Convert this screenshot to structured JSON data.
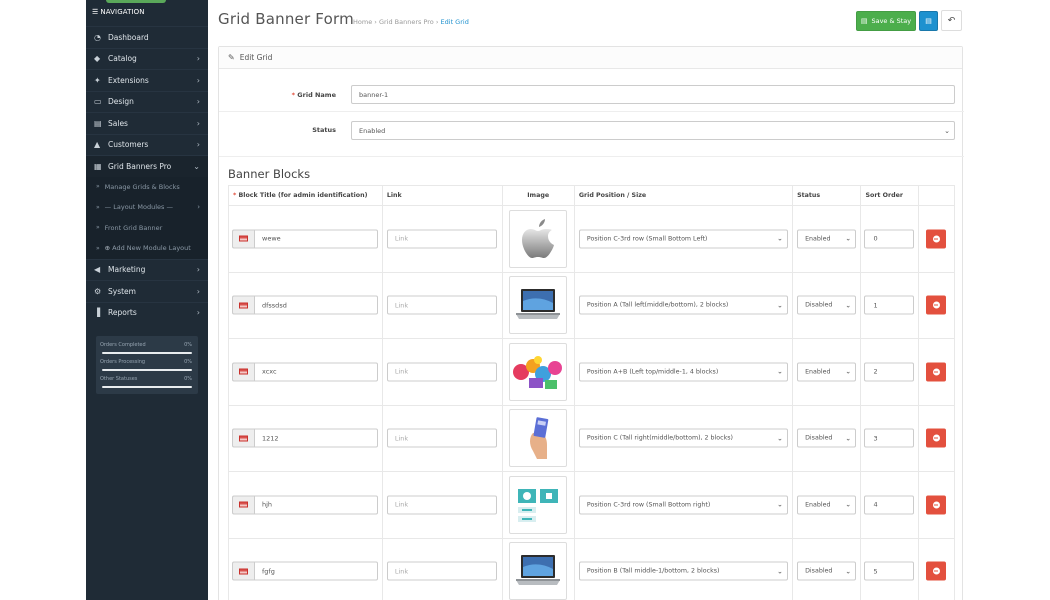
{
  "sidebar": {
    "nav_label": "NAVIGATION",
    "items": [
      {
        "label": "Dashboard",
        "icon": "dashboard-icon",
        "glyph": "◔"
      },
      {
        "label": "Catalog",
        "icon": "tag-icon",
        "glyph": "◆"
      },
      {
        "label": "Extensions",
        "icon": "puzzle-icon",
        "glyph": "✦"
      },
      {
        "label": "Design",
        "icon": "monitor-icon",
        "glyph": "▭"
      },
      {
        "label": "Sales",
        "icon": "cart-icon",
        "glyph": "▤"
      },
      {
        "label": "Customers",
        "icon": "user-icon",
        "glyph": "▲"
      },
      {
        "label": "Grid Banners Pro",
        "icon": "grid-icon",
        "glyph": "▦"
      }
    ],
    "sub_items": [
      {
        "label": "Manage Grids & Blocks"
      },
      {
        "label": "— Layout Modules —"
      },
      {
        "label": "Front Grid Banner"
      },
      {
        "label": "Add New Module Layout"
      }
    ],
    "items_after": [
      {
        "label": "Marketing",
        "icon": "share-icon",
        "glyph": "◀"
      },
      {
        "label": "System",
        "icon": "cog-icon",
        "glyph": "⚙"
      },
      {
        "label": "Reports",
        "icon": "bar-chart-icon",
        "glyph": "▐"
      }
    ],
    "stats": [
      {
        "label": "Orders Completed",
        "pct": "0%"
      },
      {
        "label": "Orders Processing",
        "pct": "0%"
      },
      {
        "label": "Other Statuses",
        "pct": "0%"
      }
    ]
  },
  "header": {
    "title": "Grid Banner Form",
    "breadcrumb": [
      "Home",
      "Grid Banners Pro",
      "Edit Grid"
    ],
    "save_stay_label": "Save & Stay"
  },
  "panel": {
    "heading": "Edit Grid",
    "grid_name_label": "Grid Name",
    "grid_name_value": "banner-1",
    "status_label": "Status",
    "status_value": "Enabled",
    "section_title": "Banner Blocks",
    "columns": [
      "Block Title (for admin identification)",
      "Link",
      "Image",
      "Grid Position / Size",
      "Status",
      "Sort Order"
    ],
    "link_placeholder": "Link",
    "rows": [
      {
        "title": "wewe",
        "position": "Position C-3rd row (Small Bottom Left)",
        "status": "Enabled",
        "sort": "0",
        "image": "apple-logo"
      },
      {
        "title": "dfssdsd",
        "position": "Position A (Tall left(middle/bottom), 2 blocks)",
        "status": "Disabled",
        "sort": "1",
        "image": "laptop"
      },
      {
        "title": "xcxc",
        "position": "Position A+B (Left top/middle-1, 4 blocks)",
        "status": "Enabled",
        "sort": "2",
        "image": "balloons"
      },
      {
        "title": "1212",
        "position": "Position C (Tall right(middle/bottom), 2 blocks)",
        "status": "Disabled",
        "sort": "3",
        "image": "hand-card"
      },
      {
        "title": "hjh",
        "position": "Position C-3rd row (Small Bottom right)",
        "status": "Enabled",
        "sort": "4",
        "image": "ui-screens"
      },
      {
        "title": "fgfg",
        "position": "Position B (Tall middle-1/bottom, 2 blocks)",
        "status": "Disabled",
        "sort": "5",
        "image": "laptop"
      }
    ]
  }
}
